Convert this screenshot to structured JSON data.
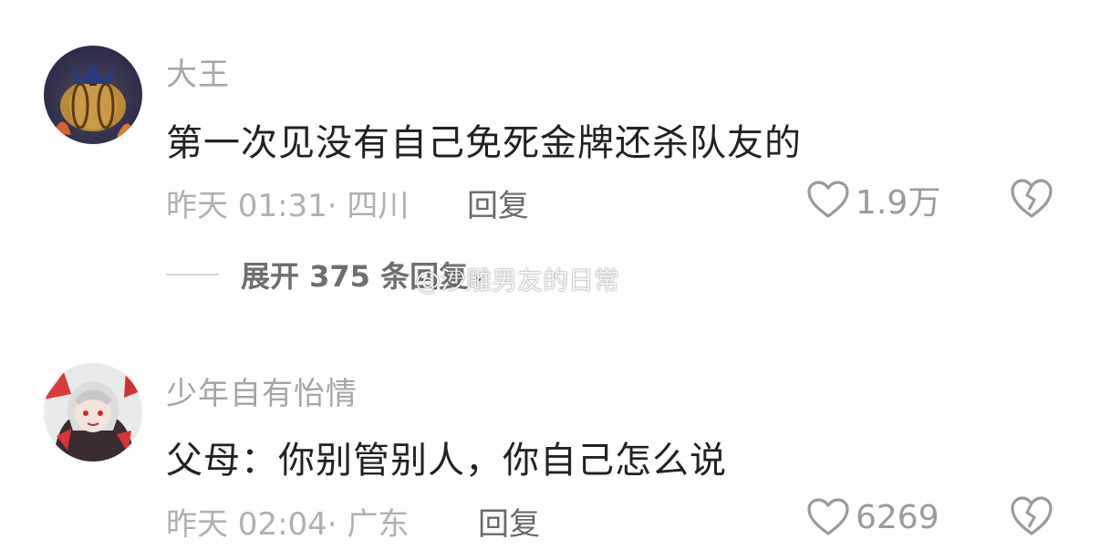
{
  "comments": [
    {
      "username": "大王",
      "content": "第一次见没有自己免死金牌还杀队友的",
      "meta": "昨天 01:31· 四川",
      "reply_label": "回复",
      "likes": "1.9万",
      "avatar_icon": "pumpkin-avatar-icon",
      "expand_label": "展开 375 条回复"
    },
    {
      "username": "少年自有怡情",
      "content": "父母：你别管别人，你自己怎么说",
      "meta": "昨天 02:04· 广东",
      "reply_label": "回复",
      "likes": "6269",
      "avatar_icon": "anime-girl-avatar-icon"
    }
  ],
  "watermark": "@沙雕男友的日常",
  "colors": {
    "username": "#a5a5a5",
    "content": "#222222",
    "meta": "#b0b0b0",
    "reply": "#6a6a6a"
  }
}
